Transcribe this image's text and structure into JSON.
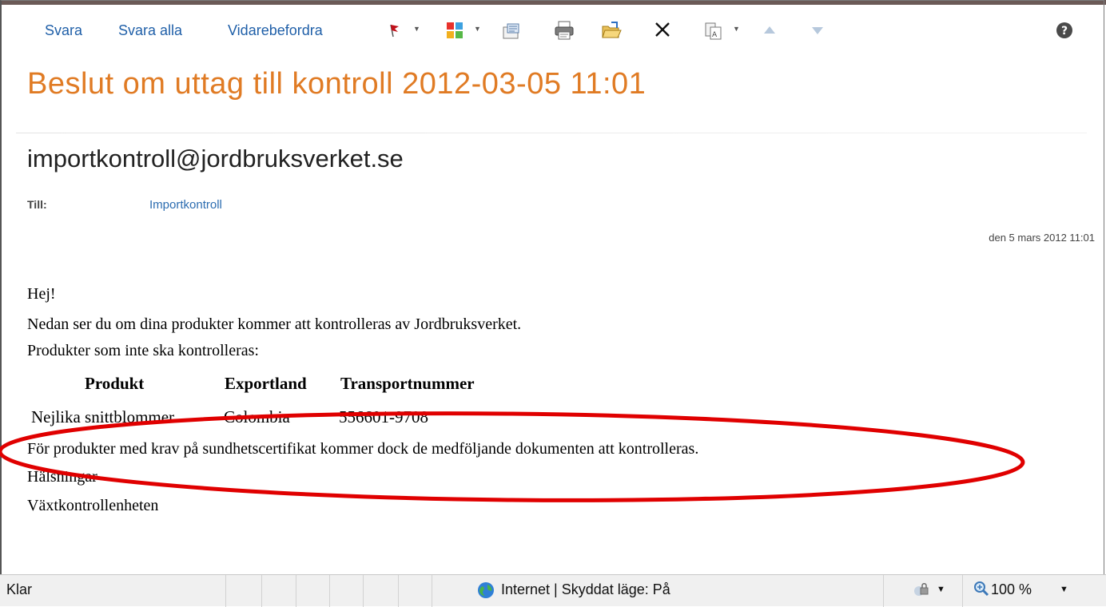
{
  "toolbar": {
    "reply_label": "Svara",
    "reply_all_label": "Svara alla",
    "forward_label": "Vidarebefordra",
    "icons": [
      "flag-icon",
      "categorize-icon",
      "move-to-folder-icon",
      "print-icon",
      "open-folder-icon",
      "delete-icon",
      "encoding-icon",
      "previous-item-icon",
      "next-item-icon",
      "help-icon"
    ]
  },
  "message": {
    "subject": "Beslut om uttag till kontroll 2012-03-05 11:01",
    "sender": "importkontroll@jordbruksverket.se",
    "to_label": "Till:",
    "to_value": "Importkontroll",
    "date": "den 5 mars 2012 11:01"
  },
  "body": {
    "greeting": "Hej!",
    "line1": "Nedan ser du om dina produkter kommer att kontrolleras av Jordbruksverket.",
    "line2": "Produkter som inte ska kontrolleras:",
    "table": {
      "headers": [
        "Produkt",
        "Exportland",
        "Transportnummer"
      ],
      "rows": [
        [
          "Nejlika snittblommer",
          "Colombia",
          "556601-9708"
        ]
      ]
    },
    "line3": "För produkter med krav på sundhetscertifikat kommer dock de medföljande dokumenten att kontrolleras.",
    "closing": "Hälsningar",
    "signature": "Växtkontrollenheten"
  },
  "statusbar": {
    "status": "Klar",
    "zone": "Internet | Skyddat läge: På",
    "zoom": "100 %"
  },
  "colors": {
    "subject": "#e07b24",
    "link": "#1f5fa8",
    "highlight_ellipse": "#e00000"
  }
}
